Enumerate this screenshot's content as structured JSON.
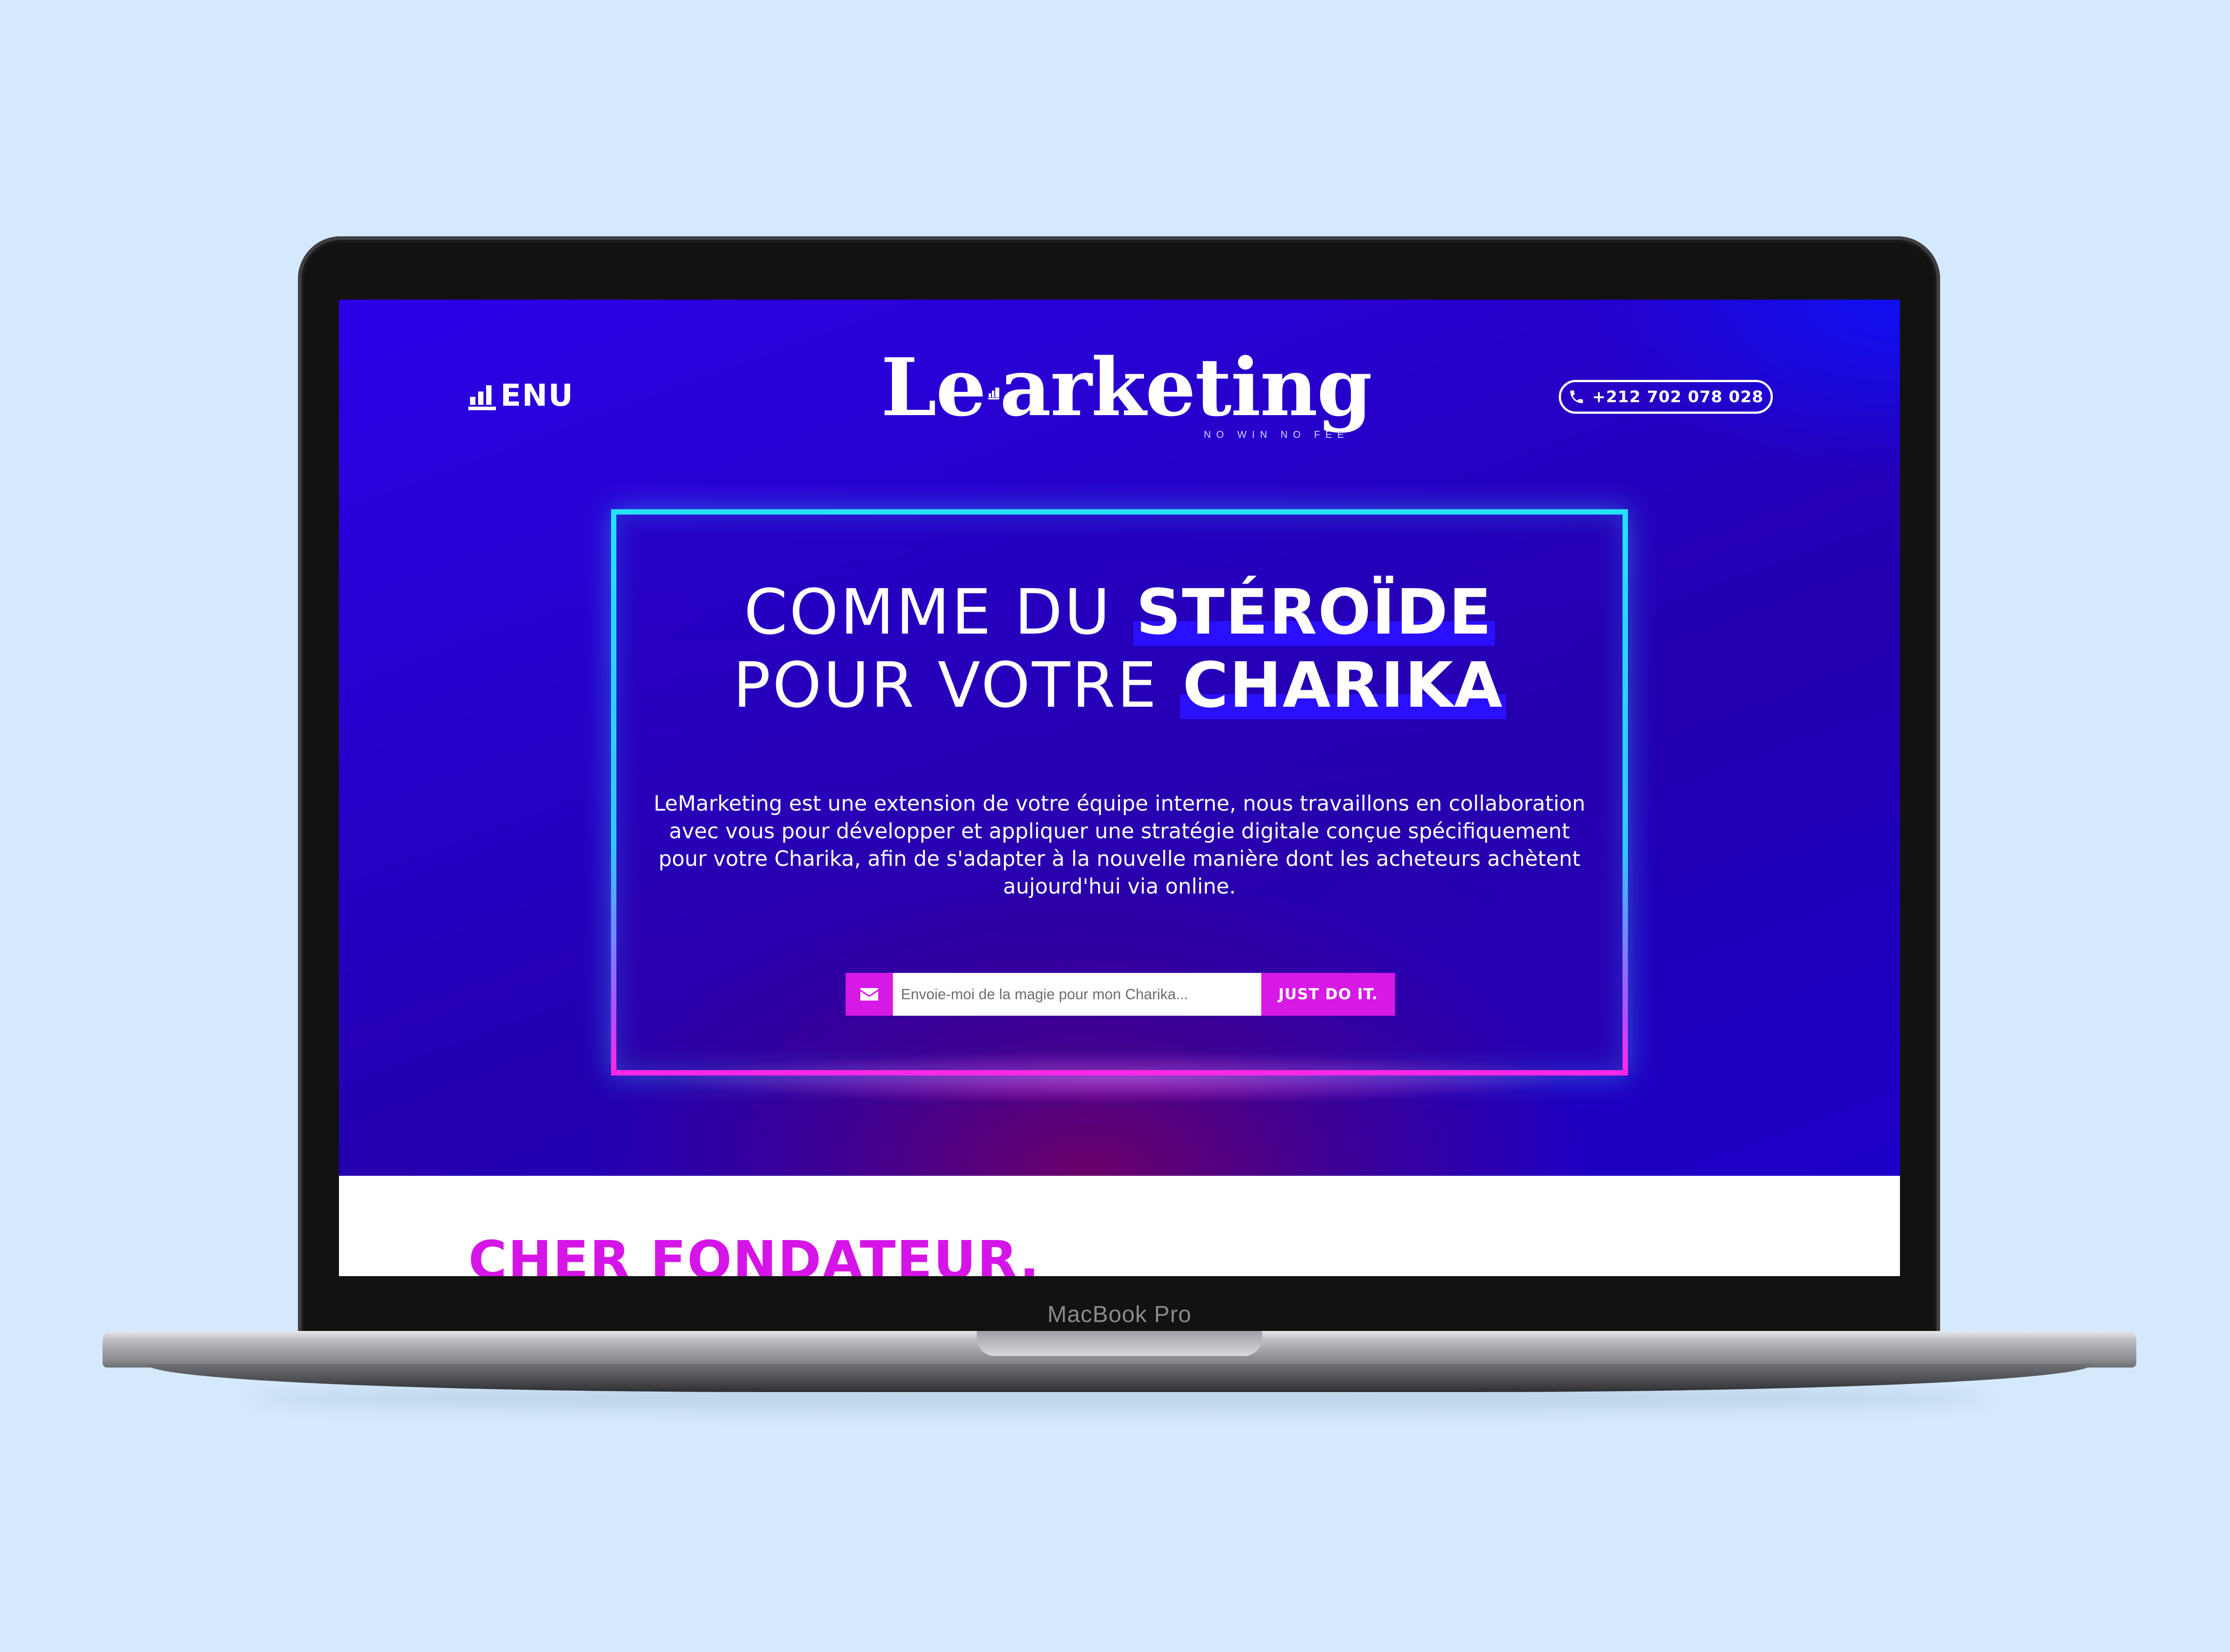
{
  "device": {
    "label": "MacBook Pro"
  },
  "header": {
    "menu_label": "ENU",
    "menu_icon": "bar-chart-icon",
    "logo": {
      "text_before": "Le",
      "text_after": "arketing",
      "mark_icon": "bar-chart-m-icon",
      "tagline": "NO WIN NO FEE"
    },
    "phone": {
      "icon": "phone-icon",
      "number": "+212 702 078 028"
    }
  },
  "hero": {
    "headline_line1_light": "COMME DU ",
    "headline_line1_bold": "STÉROÏDE",
    "headline_line2_light": "POUR VOTRE ",
    "headline_line2_bold": "CHARIKA",
    "description": "LeMarketing est une extension de votre équipe interne, nous travaillons en collaboration avec vous pour développer et appliquer une stratégie digitale conçue spécifiquement pour votre Charika, afin de s'adapter à la nouvelle manière dont les acheteurs achètent aujourd'hui via online.",
    "signup": {
      "icon": "envelope-icon",
      "placeholder": "Envoie-moi de la magie pour mon Charika...",
      "value": "",
      "button_label": "JUST DO IT."
    }
  },
  "section": {
    "title": "CHER FONDATEUR."
  },
  "colors": {
    "hero_primary": "#2600c8",
    "accent_magenta": "#d719e6",
    "neon_cyan": "#27e0ff",
    "neon_pink": "#ff28e6",
    "headline_highlight": "#2a10ff",
    "background": "#d4e9fb"
  }
}
